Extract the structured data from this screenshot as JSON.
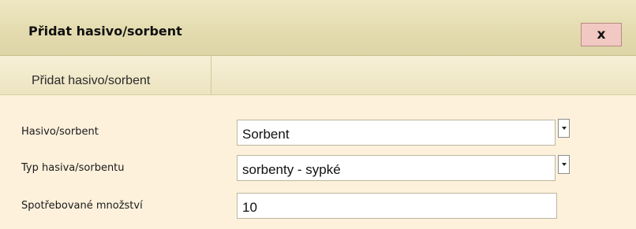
{
  "dialog": {
    "title": "Přidat hasivo/sorbent",
    "close_label": "x",
    "tabs": [
      {
        "label": "Přidat hasivo/sorbent"
      }
    ],
    "form": {
      "agent": {
        "label": "Hasivo/sorbent",
        "value": "Sorbent"
      },
      "agent_type": {
        "label": "Typ hasiva/sorbentu",
        "value": "sorbenty - sypké"
      },
      "quantity": {
        "label": "Spotřebované množství",
        "value": "10"
      }
    }
  }
}
